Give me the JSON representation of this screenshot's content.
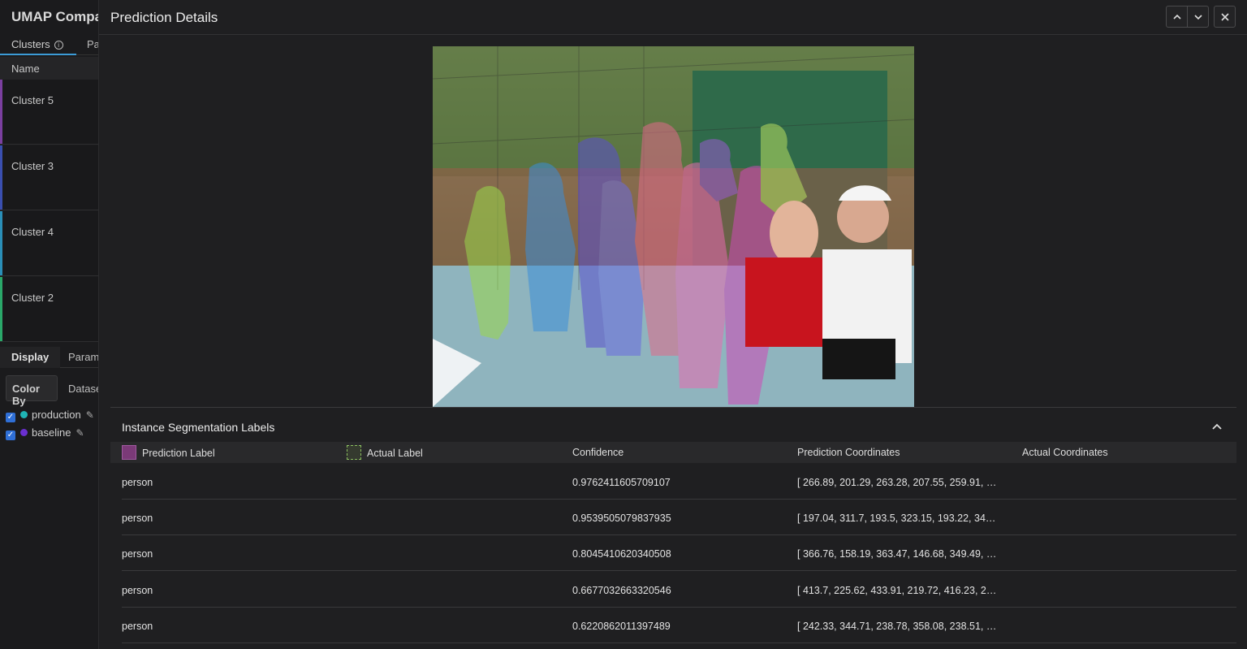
{
  "app": {
    "title": "UMAP Compar"
  },
  "left_tabs": {
    "clusters": "Clusters",
    "second": "Pa"
  },
  "left_table": {
    "name_header": "Name"
  },
  "clusters": [
    {
      "label": "Cluster 5",
      "color": "#7b3fa0"
    },
    {
      "label": "Cluster 3",
      "color": "#3a4fb0"
    },
    {
      "label": "Cluster 4",
      "color": "#2a8fb8"
    },
    {
      "label": "Cluster 2",
      "color": "#2aa86a"
    }
  ],
  "bottom_tabs": {
    "display": "Display",
    "params": "Param"
  },
  "color_by": {
    "label": "Color By",
    "option": "Datase"
  },
  "datasets": [
    {
      "name": "production",
      "color": "#1fb5b5"
    },
    {
      "name": "baseline",
      "color": "#6a2fd0"
    }
  ],
  "modal": {
    "title": "Prediction Details",
    "icons": {
      "prev": "chevron-up-icon",
      "next": "chevron-down-icon",
      "close": "close-icon"
    }
  },
  "labels_section": {
    "title": "Instance Segmentation Labels",
    "columns": [
      "Prediction Label",
      "Actual Label",
      "Confidence",
      "Prediction Coordinates",
      "Actual Coordinates"
    ],
    "rows": [
      {
        "prediction": "person",
        "actual": "",
        "confidence": "0.9762411605709107",
        "pred_coords": "[ 266.89, 201.29, 263.28, 207.55, 259.91, 21…",
        "actual_coords": ""
      },
      {
        "prediction": "person",
        "actual": "",
        "confidence": "0.9539505079837935",
        "pred_coords": "[ 197.04, 311.7, 193.5, 323.15, 193.22, 345.…",
        "actual_coords": ""
      },
      {
        "prediction": "person",
        "actual": "",
        "confidence": "0.8045410620340508",
        "pred_coords": "[ 366.76, 158.19, 363.47, 146.68, 349.49, 13…",
        "actual_coords": ""
      },
      {
        "prediction": "person",
        "actual": "",
        "confidence": "0.6677032663320546",
        "pred_coords": "[ 413.7, 225.62, 433.91, 219.72, 416.23, 207…",
        "actual_coords": ""
      },
      {
        "prediction": "person",
        "actual": "",
        "confidence": "0.6220862011397489",
        "pred_coords": "[ 242.33, 344.71, 238.78, 358.08, 238.51, 37…",
        "actual_coords": ""
      }
    ]
  }
}
